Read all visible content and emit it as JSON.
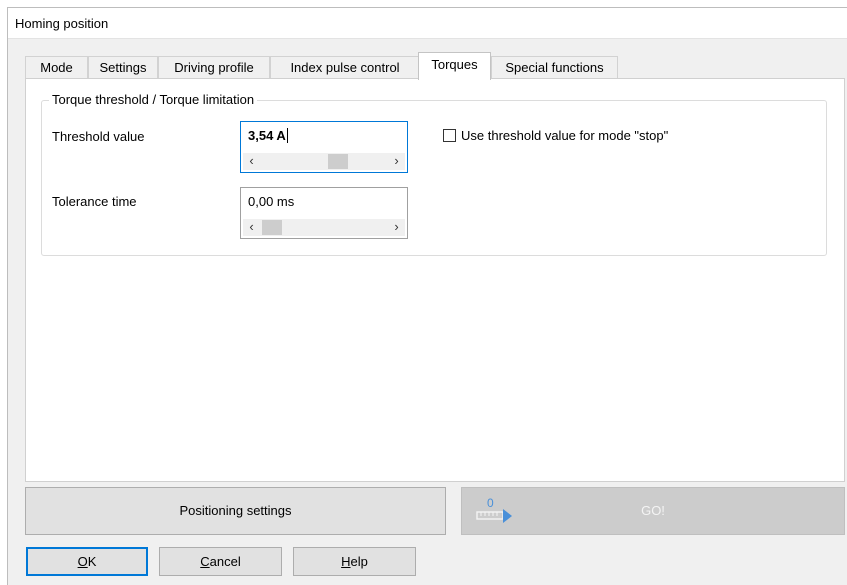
{
  "window": {
    "title": "Homing position"
  },
  "tabs": [
    {
      "label": "Mode"
    },
    {
      "label": "Settings"
    },
    {
      "label": "Driving profile"
    },
    {
      "label": "Index pulse control"
    },
    {
      "label": "Torques",
      "active": true
    },
    {
      "label": "Special functions"
    }
  ],
  "group": {
    "title": "Torque threshold / Torque limitation"
  },
  "threshold": {
    "label": "Threshold value",
    "value": "3,54 A",
    "checkbox_label": "Use threshold value for  mode \"stop\"",
    "checkbox_checked": false
  },
  "tolerance": {
    "label": "Tolerance time",
    "value": "0,00 ms"
  },
  "buttons": {
    "positioning_settings": "Positioning settings",
    "go": "GO!",
    "go_icon_number": "0",
    "ok_key": "O",
    "ok_rest": "K",
    "cancel_key": "C",
    "cancel_rest": "ancel",
    "help_key": "H",
    "help_rest": "elp"
  },
  "icons": {
    "scroll_left": "‹",
    "scroll_right": "›"
  },
  "colors": {
    "focus_border": "#0078d7",
    "panel_bg": "#f0f0f0",
    "button_bg": "#e1e1e1",
    "disabled_button_bg": "#cccccc"
  }
}
